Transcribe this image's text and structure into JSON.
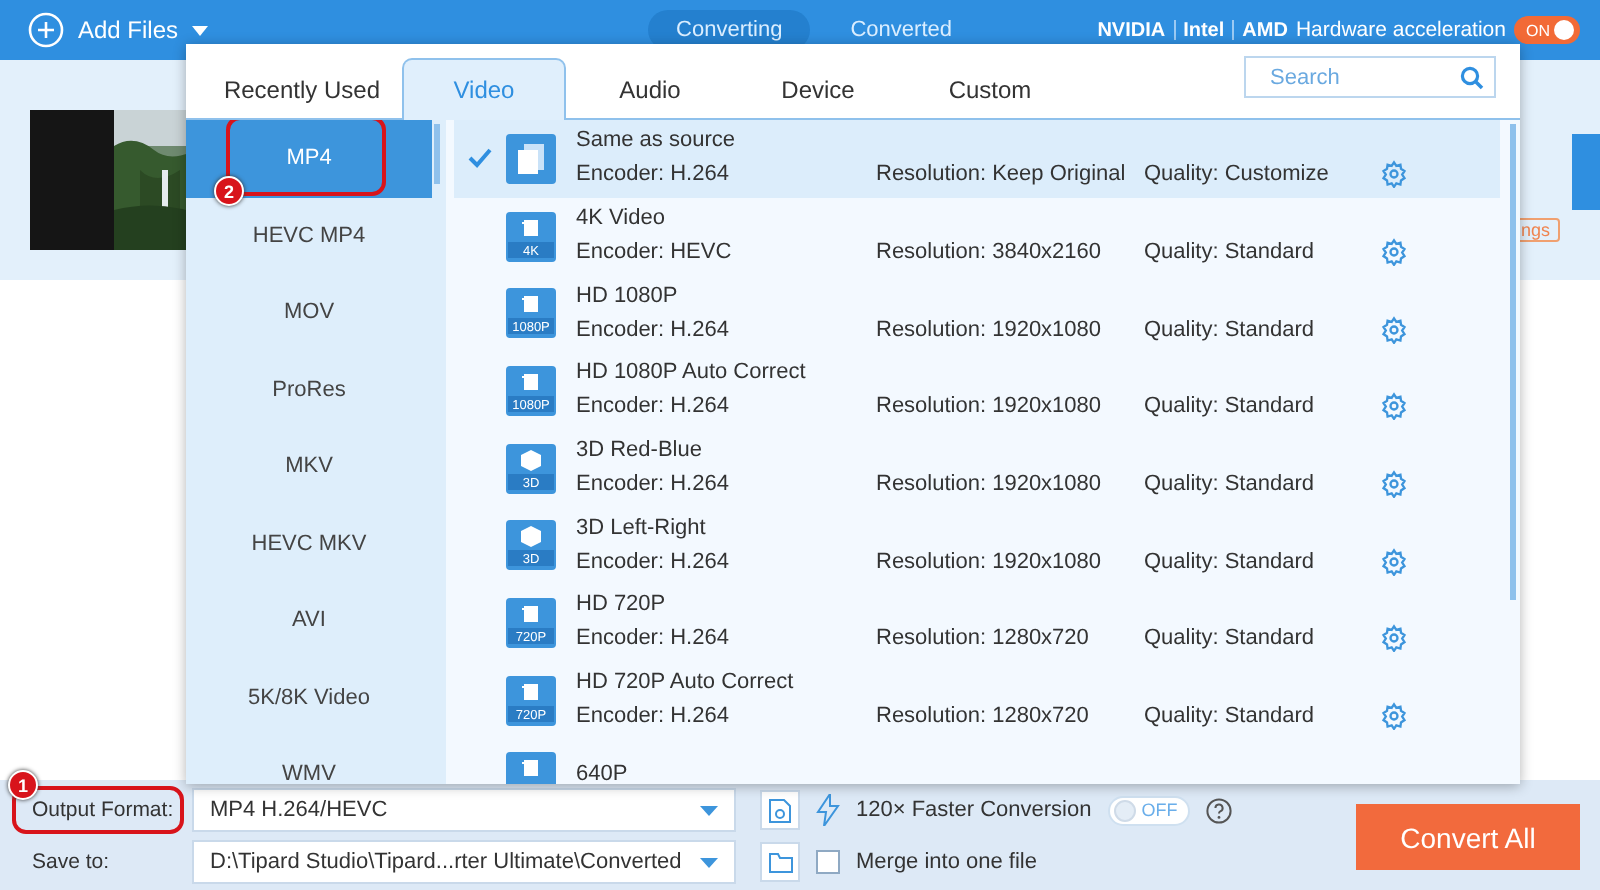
{
  "header": {
    "add_files": "Add Files",
    "tabs": [
      {
        "label": "Converting",
        "selected": true
      },
      {
        "label": "Converted",
        "selected": false
      }
    ],
    "gpu_labels": [
      "NVIDIA",
      "Intel",
      "AMD"
    ],
    "hardware_acceleration": {
      "label": "Hardware acceleration",
      "on": true,
      "state_text": "ON"
    }
  },
  "file_item": {
    "button_fragment": "ngs"
  },
  "format_popup": {
    "tabs": [
      {
        "label": "Recently Used",
        "selected": false
      },
      {
        "label": "Video",
        "selected": true
      },
      {
        "label": "Audio",
        "selected": false
      },
      {
        "label": "Device",
        "selected": false
      },
      {
        "label": "Custom",
        "selected": false
      }
    ],
    "search": {
      "placeholder": "Search"
    },
    "categories": [
      {
        "label": "MP4",
        "selected": true,
        "callout": "2"
      },
      {
        "label": "HEVC MP4",
        "selected": false
      },
      {
        "label": "MOV",
        "selected": false
      },
      {
        "label": "ProRes",
        "selected": false
      },
      {
        "label": "MKV",
        "selected": false
      },
      {
        "label": "HEVC MKV",
        "selected": false
      },
      {
        "label": "AVI",
        "selected": false
      },
      {
        "label": "5K/8K Video",
        "selected": false
      },
      {
        "label": "WMV",
        "selected": false
      }
    ],
    "presets": [
      {
        "kind": "source",
        "name": "Same as source",
        "encoder": "Encoder: H.264",
        "resolution": "Resolution: Keep Original",
        "quality": "Quality: Customize",
        "selected": true
      },
      {
        "kind": "video",
        "badge": "4K",
        "name": "4K Video",
        "encoder": "Encoder: HEVC",
        "resolution": "Resolution: 3840x2160",
        "quality": "Quality: Standard",
        "selected": false
      },
      {
        "kind": "video",
        "badge": "1080P",
        "name": "HD 1080P",
        "encoder": "Encoder: H.264",
        "resolution": "Resolution: 1920x1080",
        "quality": "Quality: Standard",
        "selected": false
      },
      {
        "kind": "video",
        "badge": "1080P",
        "name": "HD 1080P Auto Correct",
        "encoder": "Encoder: H.264",
        "resolution": "Resolution: 1920x1080",
        "quality": "Quality: Standard",
        "selected": false
      },
      {
        "kind": "stereo",
        "badge": "3D",
        "name": "3D Red-Blue",
        "encoder": "Encoder: H.264",
        "resolution": "Resolution: 1920x1080",
        "quality": "Quality: Standard",
        "selected": false
      },
      {
        "kind": "stereo",
        "badge": "3D",
        "name": "3D Left-Right",
        "encoder": "Encoder: H.264",
        "resolution": "Resolution: 1920x1080",
        "quality": "Quality: Standard",
        "selected": false
      },
      {
        "kind": "video",
        "badge": "720P",
        "name": "HD 720P",
        "encoder": "Encoder: H.264",
        "resolution": "Resolution: 1280x720",
        "quality": "Quality: Standard",
        "selected": false
      },
      {
        "kind": "video",
        "badge": "720P",
        "name": "HD 720P Auto Correct",
        "encoder": "Encoder: H.264",
        "resolution": "Resolution: 1280x720",
        "quality": "Quality: Standard",
        "selected": false
      },
      {
        "kind": "video",
        "name": "640P",
        "selected": false
      }
    ]
  },
  "bottom": {
    "output_format": {
      "label": "Output Format:",
      "callout": "1",
      "value": "MP4 H.264/HEVC"
    },
    "faster_conversion": {
      "label": "120× Faster Conversion",
      "on": false,
      "state_text": "OFF"
    },
    "save_to": {
      "label": "Save to:",
      "value": "D:\\Tipard Studio\\Tipard...rter Ultimate\\Converted"
    },
    "merge": {
      "label": "Merge into one file",
      "checked": false
    },
    "convert_button": "Convert All"
  }
}
